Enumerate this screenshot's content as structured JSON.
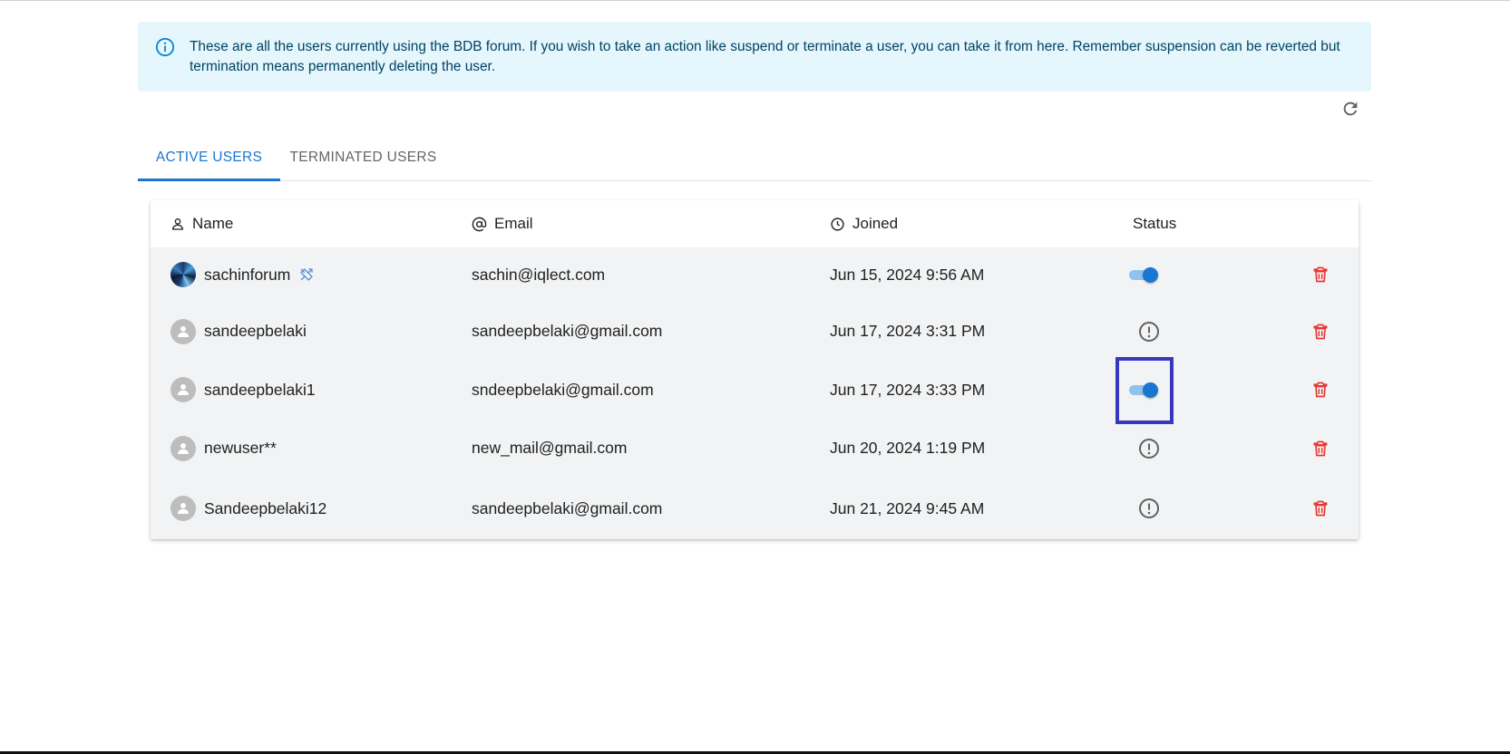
{
  "banner": {
    "icon": "info-icon",
    "text": "These are all the users currently using the BDB forum. If you wish to take an action like suspend or terminate a user, you can take it from here. Remember suspension can be reverted but termination means permanently deleting the user."
  },
  "toolbar": {
    "refresh_icon": "refresh-icon"
  },
  "tabs": [
    {
      "label": "ACTIVE USERS",
      "selected": true
    },
    {
      "label": "TERMINATED USERS",
      "selected": false
    }
  ],
  "table": {
    "columns": [
      {
        "label": "Name",
        "icon": "person-icon"
      },
      {
        "label": "Email",
        "icon": "at-icon"
      },
      {
        "label": "Joined",
        "icon": "clock-icon"
      },
      {
        "label": "Status"
      }
    ],
    "rows": [
      {
        "name": "sachinforum",
        "email": "sachin@iqlect.com",
        "joined": "Jun 15, 2024 9:56 AM",
        "status": "active",
        "avatar": "custom-avatar",
        "admin": true
      },
      {
        "name": "sandeepbelaki",
        "email": "sandeepbelaki@gmail.com",
        "joined": "Jun 17, 2024 3:31 PM",
        "status": "pending",
        "avatar": "default-avatar",
        "admin": false
      },
      {
        "name": "sandeepbelaki1",
        "email": "sndeepbelaki@gmail.com",
        "joined": "Jun 17, 2024 3:33 PM",
        "status": "active",
        "avatar": "default-avatar",
        "admin": false
      },
      {
        "name": "newuser**",
        "email": "new_mail@gmail.com",
        "joined": "Jun 20, 2024 1:19 PM",
        "status": "pending",
        "avatar": "default-avatar",
        "admin": false
      },
      {
        "name": "Sandeepbelaki12",
        "email": "sandeepbelaki@gmail.com",
        "joined": "Jun 21, 2024 9:45 AM",
        "status": "pending",
        "avatar": "default-avatar",
        "admin": false
      }
    ]
  },
  "colors": {
    "accent": "#1976d2",
    "banner_bg": "#e5f6fd",
    "delete": "#e53935",
    "highlight": "#3737c0"
  }
}
